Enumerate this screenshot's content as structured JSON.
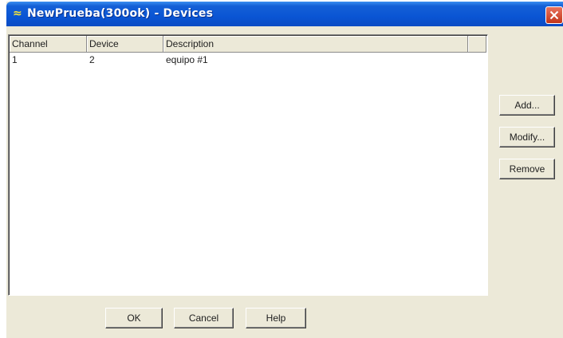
{
  "window": {
    "title": "NewPrueba(300ok) - Devices",
    "app_icon_glyph": "≈",
    "icon_names": {
      "app": "app-icon",
      "close": "close-icon"
    },
    "colors": {
      "titlebar": "#0a55d4",
      "close_button": "#d9472b",
      "face": "#ece9d8"
    }
  },
  "table": {
    "headers": [
      "Channel",
      "Device",
      "Description"
    ],
    "rows": [
      {
        "channel": "1",
        "device": "2",
        "description": "equipo #1"
      }
    ]
  },
  "side_buttons": {
    "add": "Add...",
    "modify": "Modify...",
    "remove": "Remove"
  },
  "bottom_buttons": {
    "ok": "OK",
    "cancel": "Cancel",
    "help": "Help"
  }
}
